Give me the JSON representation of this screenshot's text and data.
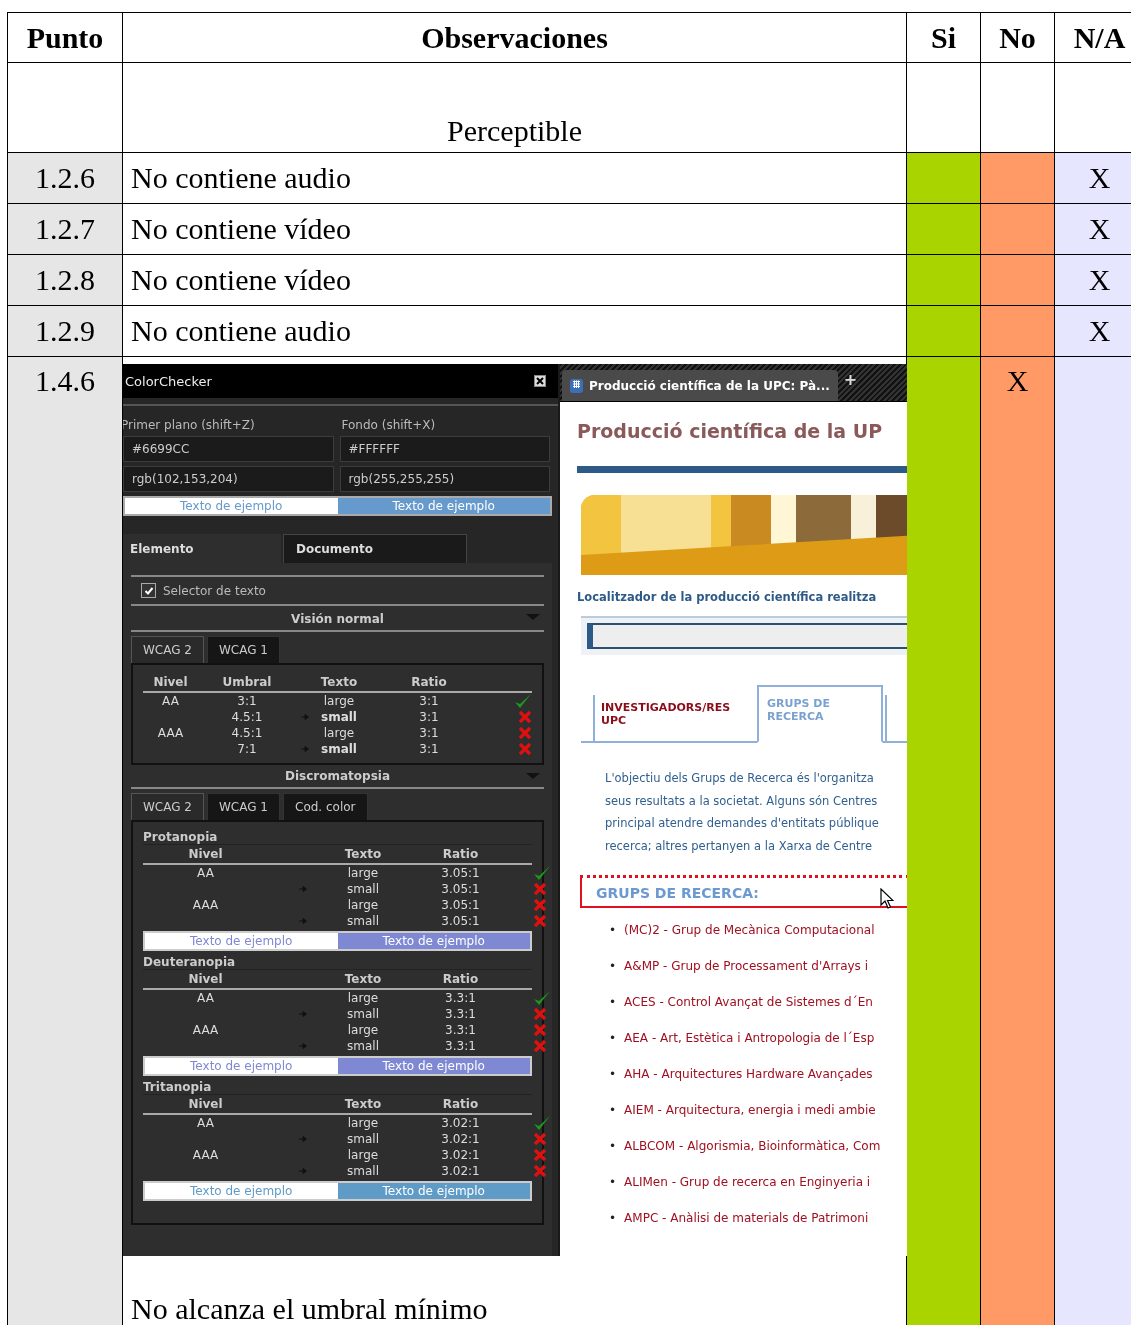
{
  "table": {
    "columns": [
      "Punto",
      "Observaciones",
      "Si",
      "No",
      "N/A"
    ],
    "section_row": {
      "label": "Perceptible"
    },
    "rows": [
      {
        "punto": "1.2.6",
        "kind": "text",
        "observacion": "No contiene audio",
        "na": "X"
      },
      {
        "punto": "1.2.7",
        "kind": "text",
        "observacion": "No contiene vídeo",
        "na": "X"
      },
      {
        "punto": "1.2.8",
        "kind": "text",
        "observacion": "No contiene vídeo",
        "na": "X"
      },
      {
        "punto": "1.2.9",
        "kind": "text",
        "observacion": "No contiene audio",
        "na": "X"
      },
      {
        "punto": "1.4.6",
        "kind": "screenshot",
        "observacion": "No alcanza el umbral mínimo",
        "no": "X"
      }
    ]
  },
  "colorchecker": {
    "title": "ColorChecker",
    "colors": [
      {
        "label": "Primer plano (shift+Z)",
        "hex": "#6699CC",
        "rgb": "rgb(102,153,204)"
      },
      {
        "label": "Fondo (shift+X)",
        "hex": "#FFFFFF",
        "rgb": "rgb(255,255,255)"
      }
    ],
    "sample": {
      "left": "Texto de ejemplo",
      "right": "Texto de ejemplo",
      "color": "#6699cc"
    },
    "tabs": [
      {
        "label": "Elemento",
        "selected": true
      },
      {
        "label": "Documento",
        "selected": false
      }
    ],
    "selector": {
      "label": "Selector de texto",
      "checked": true
    },
    "normal": {
      "title": "Visión normal",
      "tabs": [
        {
          "label": "WCAG 2",
          "selected": true
        },
        {
          "label": "WCAG 1",
          "selected": false
        }
      ],
      "columns": [
        "Nivel",
        "Umbral",
        "Texto",
        "Ratio"
      ],
      "rows": [
        {
          "nivel": "AA",
          "umbral": "3:1",
          "texto": "large",
          "ratio": "3:1",
          "current": false,
          "pass": true
        },
        {
          "umbral": "4.5:1",
          "texto": "small",
          "ratio": "3:1",
          "current": true,
          "pass": false
        },
        {
          "nivel": "AAA",
          "umbral": "4.5:1",
          "texto": "large",
          "ratio": "3:1",
          "current": false,
          "pass": false
        },
        {
          "umbral": "7:1",
          "texto": "small",
          "ratio": "3:1",
          "current": true,
          "pass": false
        }
      ]
    },
    "discro": {
      "title": "Discromatopsia",
      "tabs": [
        {
          "label": "WCAG 2",
          "selected": true
        },
        {
          "label": "WCAG 1",
          "selected": false
        },
        {
          "label": "Cod. color",
          "selected": false
        }
      ],
      "groups": [
        {
          "name": "Protanopia",
          "columns": [
            "Nivel",
            "Texto",
            "Ratio"
          ],
          "rows": [
            {
              "nivel": "AA",
              "texto": "large",
              "ratio": "3.05:1",
              "current": false,
              "pass": true
            },
            {
              "texto": "small",
              "ratio": "3.05:1",
              "current": true,
              "pass": false
            },
            {
              "nivel": "AAA",
              "texto": "large",
              "ratio": "3.05:1",
              "current": false,
              "pass": false
            },
            {
              "texto": "small",
              "ratio": "3.05:1",
              "current": true,
              "pass": false
            }
          ],
          "sample": {
            "left": "Texto de ejemplo",
            "right": "Texto de ejemplo",
            "color": "#7f88d2"
          }
        },
        {
          "name": "Deuteranopia",
          "columns": [
            "Nivel",
            "Texto",
            "Ratio"
          ],
          "rows": [
            {
              "nivel": "AA",
              "texto": "large",
              "ratio": "3.3:1",
              "current": false,
              "pass": true
            },
            {
              "texto": "small",
              "ratio": "3.3:1",
              "current": true,
              "pass": false
            },
            {
              "nivel": "AAA",
              "texto": "large",
              "ratio": "3.3:1",
              "current": false,
              "pass": false
            },
            {
              "texto": "small",
              "ratio": "3.3:1",
              "current": true,
              "pass": false
            }
          ],
          "sample": {
            "left": "Texto de ejemplo",
            "right": "Texto de ejemplo",
            "color": "#7f88d2"
          }
        },
        {
          "name": "Tritanopia",
          "columns": [
            "Nivel",
            "Texto",
            "Ratio"
          ],
          "rows": [
            {
              "nivel": "AA",
              "texto": "large",
              "ratio": "3.02:1",
              "current": false,
              "pass": true
            },
            {
              "texto": "small",
              "ratio": "3.02:1",
              "current": true,
              "pass": false
            },
            {
              "nivel": "AAA",
              "texto": "large",
              "ratio": "3.02:1",
              "current": false,
              "pass": false
            },
            {
              "texto": "small",
              "ratio": "3.02:1",
              "current": true,
              "pass": false
            }
          ],
          "sample": {
            "left": "Texto de ejemplo",
            "right": "Texto de ejemplo",
            "color": "#5f9bc7"
          }
        }
      ]
    }
  },
  "browser": {
    "tab": "Producció científica de la UPC: Pà...",
    "new_tab": "+",
    "heading": "Producció científica de la UP",
    "banner": {
      "kind": "picture"
    },
    "locator": "Localitzador de la producció científica realitza",
    "nav_tabs": [
      {
        "label": "INVESTIGADORS/RES UPC",
        "selected": false
      },
      {
        "label": "GRUPS DE RECERCA",
        "selected": true
      }
    ],
    "intro_lines": [
      "L'objectiu dels Grups de Recerca és l'organitza",
      "seus resultats a la societat. Alguns són Centres",
      "principal atendre demandes d'entitats públique",
      "recerca; altres pertanyen a la Xarxa de Centre"
    ],
    "groups_heading": "GRUPS DE RECERCA:",
    "groups": [
      {
        "bullet": "•",
        "label": "(MC)2 - Grup de Mecànica Computacional"
      },
      {
        "bullet": "•",
        "label": "A&MP - Grup de Processament d'Arrays i"
      },
      {
        "bullet": "•",
        "label": "ACES - Control Avançat de Sistemes d´En"
      },
      {
        "bullet": "•",
        "label": "AEA - Art, Estètica i Antropologia de l´Esp"
      },
      {
        "bullet": "•",
        "label": "AHA - Arquitectures Hardware Avançades"
      },
      {
        "bullet": "•",
        "label": "AIEM - Arquitectura, energia i medi ambie"
      },
      {
        "bullet": "•",
        "label": "ALBCOM - Algorismia, Bioinformàtica, Com"
      },
      {
        "bullet": "•",
        "label": "ALIMen - Grup de recerca en Enginyeria i"
      },
      {
        "bullet": "•",
        "label": "AMPC - Anàlisi de materials de Patrimoni"
      }
    ]
  }
}
